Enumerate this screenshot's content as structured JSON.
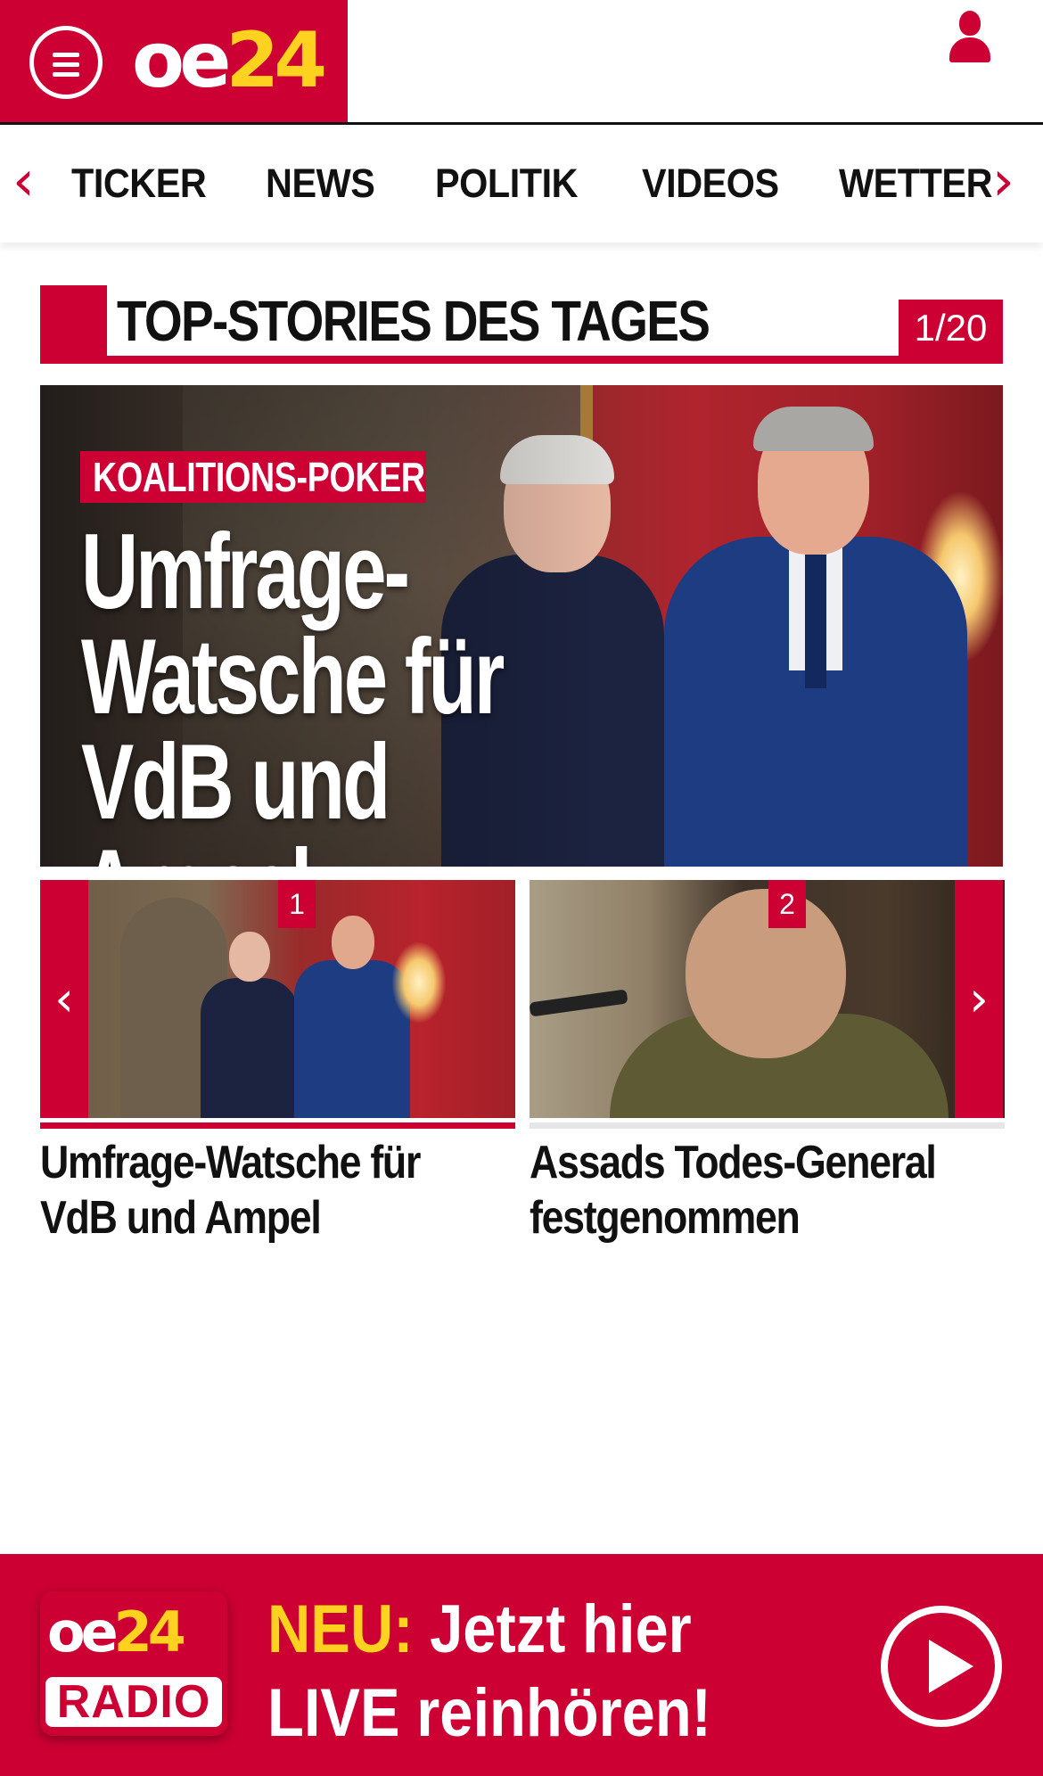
{
  "header": {
    "logo_oe": "oe",
    "logo_24": "24",
    "menu_icon": "hamburger-menu-icon",
    "user_icon": "user-icon"
  },
  "nav": {
    "left_arrow": "‹",
    "right_arrow": "›",
    "items": [
      "TICKER",
      "NEWS",
      "POLITIK",
      "VIDEOS",
      "WETTER"
    ]
  },
  "top_stories": {
    "title": "TOP-STORIES DES TAGES",
    "counter": "1/20"
  },
  "hero": {
    "kicker": "KOALITIONS-POKER",
    "title": "Umfrage-Watsche für VdB und Ampel"
  },
  "carousel": {
    "left_arrow": "‹",
    "right_arrow": "›",
    "cards": [
      {
        "number": "1",
        "title": "Umfrage-Watsche für VdB und Ampel"
      },
      {
        "number": "2",
        "title": "Assads Todes-General festgenommen"
      }
    ]
  },
  "radio": {
    "logo_oe": "oe",
    "logo_24": "24",
    "logo_radio": "RADIO",
    "neu": "NEU:",
    "line1": "Jetzt hier",
    "line2": "LIVE reinhören!",
    "play_icon": "play-icon"
  },
  "colors": {
    "brand_red": "#cc0033",
    "brand_yellow": "#ffd21f"
  }
}
